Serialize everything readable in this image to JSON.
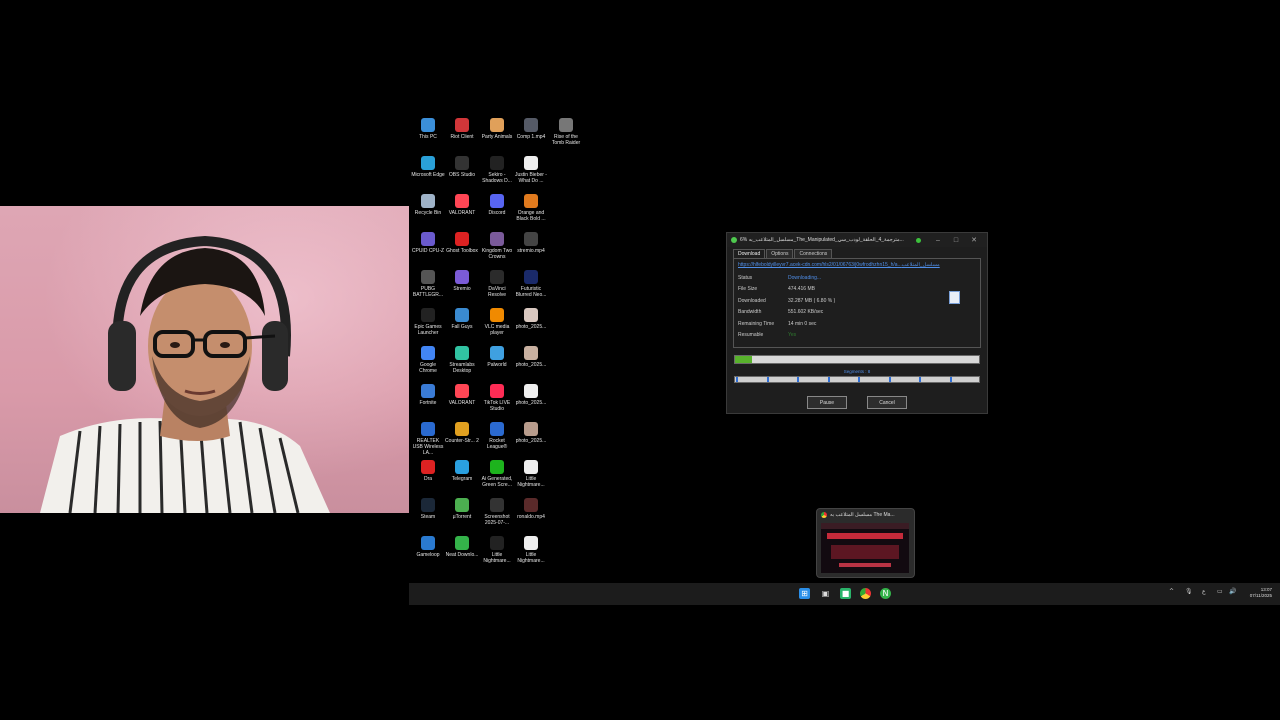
{
  "desktop": {
    "icons": [
      {
        "label": "This PC",
        "icon": "computer-icon",
        "color": "#3b8fd9"
      },
      {
        "label": "Riot Client",
        "icon": "riot-icon",
        "color": "#d13639"
      },
      {
        "label": "Party Animals",
        "icon": "dog-icon",
        "color": "#e0a05a"
      },
      {
        "label": "Comp 1.mp4",
        "icon": "video-thumb-icon",
        "color": "#555a66"
      },
      {
        "label": "Rise of the Tomb Raider",
        "icon": "game-icon",
        "color": "#777"
      },
      {
        "label": "Microsoft Edge",
        "icon": "edge-icon",
        "color": "#2aa0d8"
      },
      {
        "label": "OBS Studio",
        "icon": "obs-icon",
        "color": "#333"
      },
      {
        "label": "Sekiro - Shadows D...",
        "icon": "game-icon",
        "color": "#222"
      },
      {
        "label": "Justin Bieber - What Do ...",
        "icon": "file-icon",
        "color": "#eee"
      },
      {
        "label": "Recycle Bin",
        "icon": "recycle-bin-icon",
        "color": "#9fb3c8"
      },
      {
        "label": "VALORANT",
        "icon": "valorant-icon",
        "color": "#ff4655"
      },
      {
        "label": "Discord",
        "icon": "discord-icon",
        "color": "#5865f2"
      },
      {
        "label": "Orange and Black Bold ...",
        "icon": "image-icon",
        "color": "#e07a1e"
      },
      {
        "label": "CPUID CPU-Z",
        "icon": "cpu-icon",
        "color": "#6a5acd"
      },
      {
        "label": "Ghost Toolbox",
        "icon": "ghost-icon",
        "color": "#d22"
      },
      {
        "label": "Kingdom Two Crowns",
        "icon": "game-icon",
        "color": "#7a5a9a"
      },
      {
        "label": "stremio.mp4",
        "icon": "video-thumb-icon",
        "color": "#444"
      },
      {
        "label": "PUBG BATTLEGR...",
        "icon": "pubg-icon",
        "color": "#555"
      },
      {
        "label": "Stremio",
        "icon": "stremio-icon",
        "color": "#7b5bd6"
      },
      {
        "label": "DaVinci Resolve",
        "icon": "davinci-icon",
        "color": "#2b2b2b"
      },
      {
        "label": "Futuristic Blurred Neo...",
        "icon": "image-icon",
        "color": "#1a2a6a"
      },
      {
        "label": "Epic Games Launcher",
        "icon": "epic-icon",
        "color": "#222"
      },
      {
        "label": "Fall Guys",
        "icon": "fallguys-icon",
        "color": "#3a8ad0"
      },
      {
        "label": "VLC media player",
        "icon": "vlc-icon",
        "color": "#f08a00"
      },
      {
        "label": "photo_2025...",
        "icon": "photo-icon",
        "color": "#d9c8c0"
      },
      {
        "label": "Google Chrome",
        "icon": "chrome-icon",
        "color": "#4285f4"
      },
      {
        "label": "Streamlabs Desktop",
        "icon": "streamlabs-icon",
        "color": "#31c3a2"
      },
      {
        "label": "Palworld",
        "icon": "palworld-icon",
        "color": "#3fa0e0"
      },
      {
        "label": "photo_2025...",
        "icon": "photo-icon",
        "color": "#c8b0a0"
      },
      {
        "label": "Fortnite",
        "icon": "fortnite-icon",
        "color": "#3a7bd5"
      },
      {
        "label": "VALORANT",
        "icon": "valorant-icon",
        "color": "#ff4655"
      },
      {
        "label": "TikTok LIVE Studio",
        "icon": "tiktok-icon",
        "color": "#fe2c55"
      },
      {
        "label": "photo_2025...",
        "icon": "photo-icon",
        "color": "#eee"
      },
      {
        "label": "REALTEK USB Wireless LA...",
        "icon": "realtek-icon",
        "color": "#2a6ad0"
      },
      {
        "label": "Counter-Str... 2",
        "icon": "cs-icon",
        "color": "#e0a020"
      },
      {
        "label": "Rocket League®",
        "icon": "rocket-icon",
        "color": "#2b6ad0"
      },
      {
        "label": "photo_2025...",
        "icon": "photo-icon",
        "color": "#b89c8c"
      },
      {
        "label": "Dra",
        "icon": "app-icon",
        "color": "#d22"
      },
      {
        "label": "Telegram",
        "icon": "telegram-icon",
        "color": "#2aa0e0"
      },
      {
        "label": "Ai Generated, Green Scre...",
        "icon": "image-icon",
        "color": "#1db31d"
      },
      {
        "label": "Little Nightmare...",
        "icon": "file-icon",
        "color": "#eee"
      },
      {
        "label": "Steam",
        "icon": "steam-icon",
        "color": "#1b2838"
      },
      {
        "label": "µTorrent",
        "icon": "utorrent-icon",
        "color": "#4caf50"
      },
      {
        "label": "Screenshot 2025-07-...",
        "icon": "image-icon",
        "color": "#333"
      },
      {
        "label": "ronaldo.mp4",
        "icon": "video-thumb-icon",
        "color": "#5a2a2a"
      },
      {
        "label": "Gameloop",
        "icon": "gameloop-icon",
        "color": "#2a7ad0"
      },
      {
        "label": "Neat Downlo...",
        "icon": "neat-download-icon",
        "color": "#34b34a"
      },
      {
        "label": "Little Nightmare...",
        "icon": "game-icon",
        "color": "#222"
      },
      {
        "label": "Little Nightmare...",
        "icon": "file-icon",
        "color": "#eee"
      }
    ]
  },
  "dialog": {
    "title": "6% مسلسل_المتلاعب_به_The_Manipulated_مترجمة_4_الحلقة_لودب_سي...",
    "tabs": [
      "Download",
      "Options",
      "Connections"
    ],
    "url": "https://hlfeboldyilleyvr7.acek-cdn.com/hls2/01/06763/j0wfrodhzhn15_h/a...مسلسل_المتلاعب",
    "rows": [
      {
        "k": "Status",
        "v": "Downloading..."
      },
      {
        "k": "File Size",
        "v": "474.416 MB"
      },
      {
        "k": "Downloaded",
        "v": "32.287 MB ( 6.80 % )"
      },
      {
        "k": "Bandwidth",
        "v": "551.602 KB/sec"
      },
      {
        "k": "Remaining Time",
        "v": "14 min  0 sec"
      },
      {
        "k": "Resumable",
        "v": "Yes"
      }
    ],
    "progress": 0.068,
    "segments_label": "Segments : 8",
    "pause_label": "Pause",
    "cancel_label": "Cancel"
  },
  "preview": {
    "title": "مسلسل المتلاعب به The Ma..."
  },
  "taskbar": {
    "time": "13:07",
    "date": "07/11/2025"
  }
}
